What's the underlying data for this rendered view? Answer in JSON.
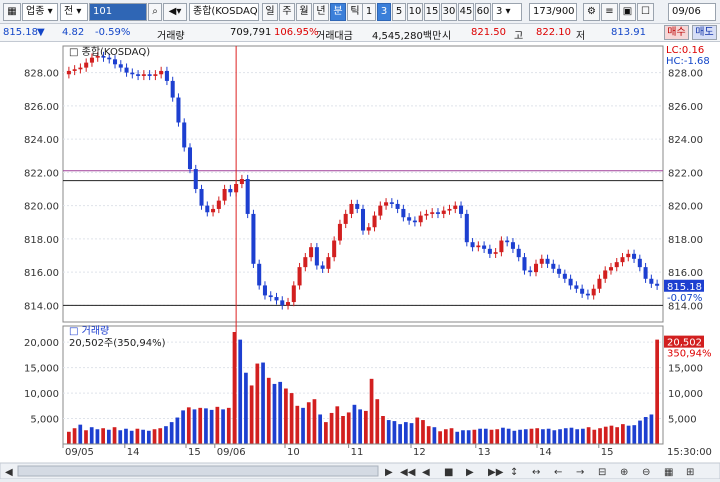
{
  "toolbar": {
    "market_select": "업종",
    "market_type": "전",
    "code": "101",
    "name": "종합(KOSDAQ)",
    "period_buttons": [
      "일",
      "주",
      "월",
      "년",
      "분",
      "틱"
    ],
    "period_active": "분",
    "interval_buttons": [
      "1",
      "3",
      "5",
      "10",
      "15",
      "30",
      "45",
      "60"
    ],
    "interval_active": "3",
    "interval_select": "3",
    "count": "173/900",
    "date": "09/06"
  },
  "info": {
    "price": "815.18",
    "arrow": "▼",
    "change": "4.82",
    "change_pct": "-0.59%",
    "volume_label": "거래량",
    "volume": "709,791",
    "volume_ratio": "106.95%",
    "amount_label": "거래대금",
    "amount": "4,545,280백만",
    "high_label": "시",
    "open": "821.50",
    "high_label2": "고",
    "high": "822.10",
    "low_label": "저",
    "low": "813.91",
    "buy_label": "매수",
    "sell_label": "매도"
  },
  "colors": {
    "up": "#d21f1f",
    "down": "#1d3fd0",
    "accent": "#3b7fd9"
  },
  "chart_data": [
    {
      "type": "candlestick",
      "title": "종합(KOSDAQ)",
      "ylim": [
        813,
        829.6
      ],
      "y_ticks": [
        "828.00",
        "826.00",
        "824.00",
        "822.00",
        "820.00",
        "818.00",
        "816.00",
        "814.00"
      ],
      "x_labels": [
        "09/05",
        "14",
        "15",
        "09/06",
        "10",
        "11",
        "12",
        "13",
        "14",
        "15"
      ],
      "right_top_labels": [
        "LC:0.16",
        "HC:-1.68"
      ],
      "last_price_label": "815.18",
      "last_change_label": "-0.07%",
      "h_lines": [
        822.1,
        821.5,
        814.0
      ],
      "close_series": [
        828.1,
        828.2,
        828.3,
        828.6,
        828.9,
        829.0,
        828.9,
        828.8,
        828.5,
        828.3,
        828.0,
        827.9,
        827.8,
        827.9,
        827.8,
        827.9,
        828.1,
        827.5,
        826.5,
        825.0,
        823.5,
        822.2,
        821.0,
        820.0,
        819.6,
        819.8,
        820.3,
        821.0,
        820.8,
        821.3,
        821.6,
        819.5,
        816.5,
        815.2,
        814.6,
        814.5,
        814.3,
        814.0,
        814.2,
        815.2,
        816.3,
        816.9,
        817.5,
        816.4,
        816.2,
        816.9,
        817.9,
        818.9,
        819.5,
        820.1,
        819.8,
        818.5,
        818.7,
        819.4,
        820.0,
        820.2,
        820.1,
        819.8,
        819.3,
        819.1,
        819.0,
        819.4,
        819.5,
        819.6,
        819.5,
        819.7,
        819.8,
        820.0,
        819.5,
        817.8,
        817.5,
        817.6,
        817.4,
        817.1,
        817.2,
        817.9,
        817.8,
        817.4,
        816.9,
        816.1,
        816.0,
        816.5,
        816.8,
        816.5,
        816.2,
        815.9,
        815.6,
        815.2,
        815.0,
        814.7,
        814.6,
        815.0,
        815.6,
        816.1,
        816.3,
        816.6,
        816.9,
        817.1,
        816.8,
        816.3,
        815.6,
        815.3,
        815.18
      ],
      "crosshair_index": 29
    },
    {
      "type": "bar",
      "title": "거래량",
      "subtitle": "20,502주(350,94%)",
      "ylim": [
        0,
        22000
      ],
      "y_ticks": [
        "20,000",
        "15,000",
        "10,000",
        "5,000"
      ],
      "last_value_label": "20,502",
      "last_ratio_label": "350,94%",
      "time_label": "15:30:00",
      "values": [
        2400,
        3100,
        3800,
        2700,
        3300,
        2900,
        3100,
        2800,
        3300,
        2700,
        3000,
        2600,
        3000,
        2800,
        2600,
        2900,
        3100,
        3500,
        4300,
        5200,
        6600,
        7200,
        6800,
        7100,
        7000,
        6700,
        7300,
        6800,
        7100,
        22000,
        20500,
        14000,
        11500,
        15800,
        16000,
        13000,
        11800,
        12200,
        10900,
        10000,
        7500,
        7100,
        8200,
        8800,
        5800,
        4300,
        6100,
        7400,
        5500,
        6200,
        7700,
        6800,
        6500,
        12800,
        8800,
        5500,
        4700,
        4500,
        3900,
        4300,
        4100,
        5200,
        4700,
        3500,
        3300,
        2500,
        2900,
        3100,
        2400,
        2700,
        2700,
        2800,
        3000,
        3000,
        2800,
        2900,
        3200,
        3000,
        2600,
        2800,
        2900,
        3000,
        3100,
        2900,
        3000,
        2700,
        2900,
        3100,
        3200,
        2900,
        3000,
        3300,
        2800,
        3100,
        3400,
        3600,
        3300,
        3900,
        3600,
        3700,
        4600,
        5300,
        5800,
        20502
      ],
      "colors_up": [
        1,
        1,
        0,
        1,
        0,
        0,
        1,
        0,
        1,
        0,
        0,
        0,
        1,
        0,
        0,
        1,
        1,
        0,
        0,
        0,
        0,
        1,
        0,
        1,
        0,
        0,
        1,
        0,
        1,
        1,
        0,
        0,
        1,
        1,
        0,
        1,
        0,
        0,
        1,
        1,
        1,
        0,
        1,
        1,
        0,
        1,
        1,
        1,
        1,
        1,
        0,
        0,
        1,
        1,
        1,
        1,
        0,
        0,
        0,
        0,
        0,
        1,
        1,
        1,
        0,
        1,
        1,
        1,
        0,
        0,
        0,
        1,
        0,
        0,
        1,
        1,
        0,
        0,
        0,
        0,
        0,
        1,
        1,
        0,
        0,
        0,
        0,
        0,
        0,
        0,
        0,
        1,
        1,
        1,
        1,
        1,
        1,
        1,
        0,
        0,
        0,
        0,
        0,
        1
      ]
    }
  ]
}
